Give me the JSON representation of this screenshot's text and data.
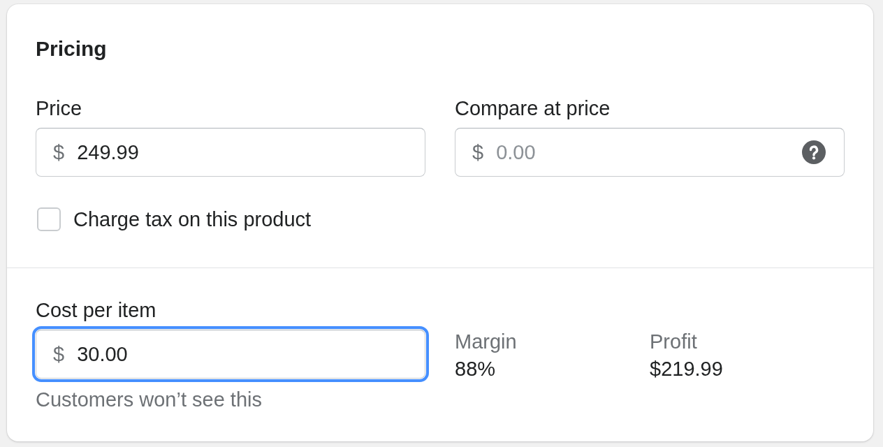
{
  "card": {
    "title": "Pricing"
  },
  "fields": [
    {
      "label": "Price",
      "prefix": "$",
      "value": "249.99"
    },
    {
      "label": "Compare at price",
      "prefix": "$",
      "placeholder": "0.00",
      "help_icon": true
    }
  ],
  "tax_checkbox": {
    "label": "Charge tax on this product",
    "checked": false
  },
  "cost": {
    "label": "Cost per item",
    "prefix": "$",
    "value": "30.00",
    "focused": true,
    "help_text": "Customers won’t see this"
  },
  "stats": [
    {
      "label": "Margin",
      "value": "88%"
    },
    {
      "label": "Profit",
      "value": "$219.99"
    }
  ]
}
